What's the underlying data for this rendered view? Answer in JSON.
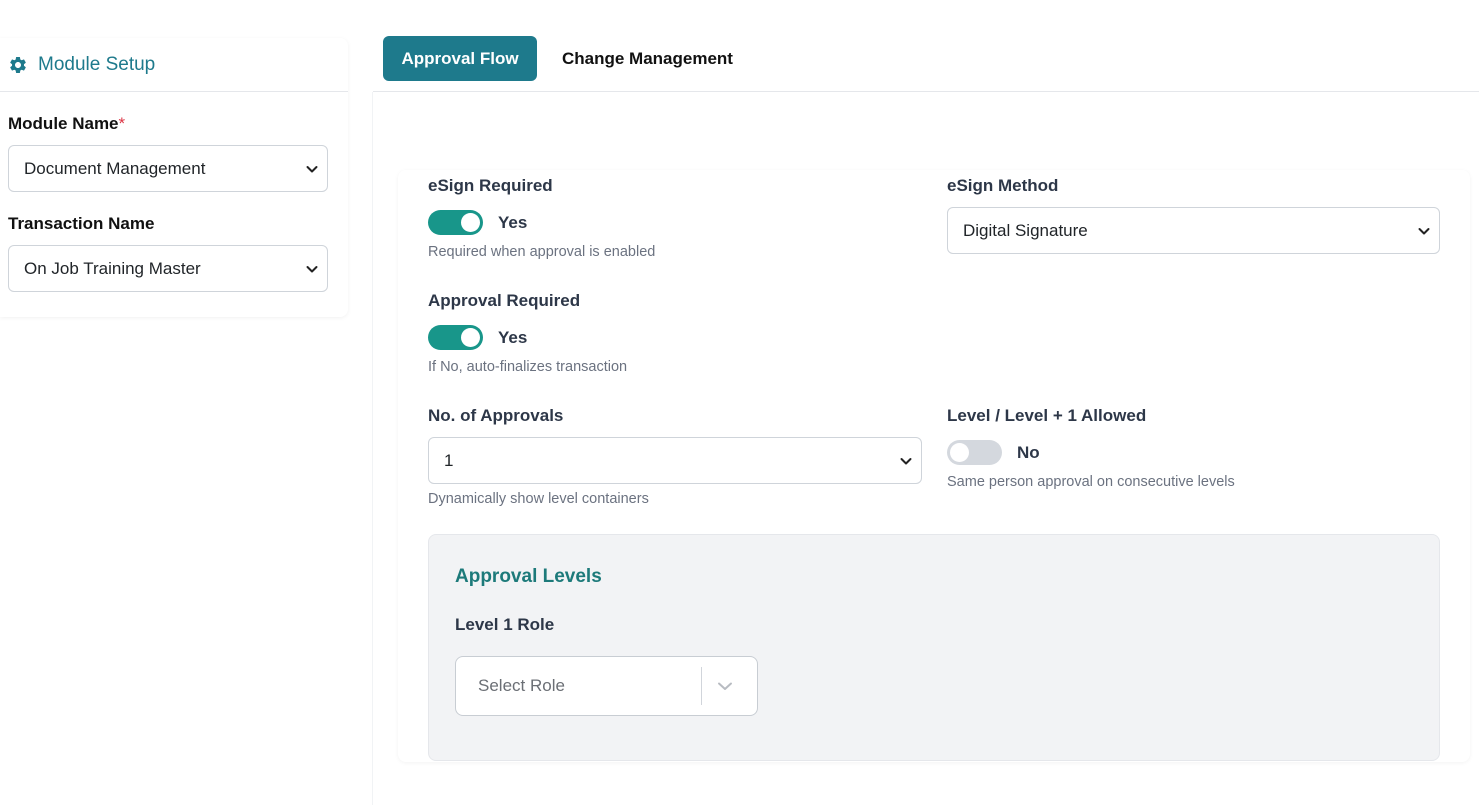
{
  "sidebar": {
    "title": "Module Setup",
    "module_name_label": "Module Name",
    "required_mark": "*",
    "module_name_value": "Document Management",
    "transaction_name_label": "Transaction Name",
    "transaction_name_value": "On Job Training Master"
  },
  "tabs": {
    "active": "Approval Flow",
    "inactive": "Change Management"
  },
  "form": {
    "esign_required_label": "eSign Required",
    "esign_required_state": "Yes",
    "esign_required_hint": "Required when approval is enabled",
    "esign_method_label": "eSign Method",
    "esign_method_value": "Digital Signature",
    "approval_required_label": "Approval Required",
    "approval_required_state": "Yes",
    "approval_required_hint": "If No, auto-finalizes transaction",
    "num_approvals_label": "No. of Approvals",
    "num_approvals_value": "1",
    "num_approvals_hint": "Dynamically show level containers",
    "level_allowed_label": "Level / Level + 1 Allowed",
    "level_allowed_state": "No",
    "level_allowed_hint": "Same person approval on consecutive levels"
  },
  "levels": {
    "title": "Approval Levels",
    "level1_label": "Level 1 Role",
    "role_placeholder": "Select Role"
  },
  "colors": {
    "accent": "#1e7a8c",
    "toggle_on": "#18968a",
    "toggle_off": "#d4d8de",
    "levels_title": "#1d7a7a"
  },
  "icons": {
    "module_setup": "gear-icon",
    "dropdown": "chevron-down-icon"
  }
}
